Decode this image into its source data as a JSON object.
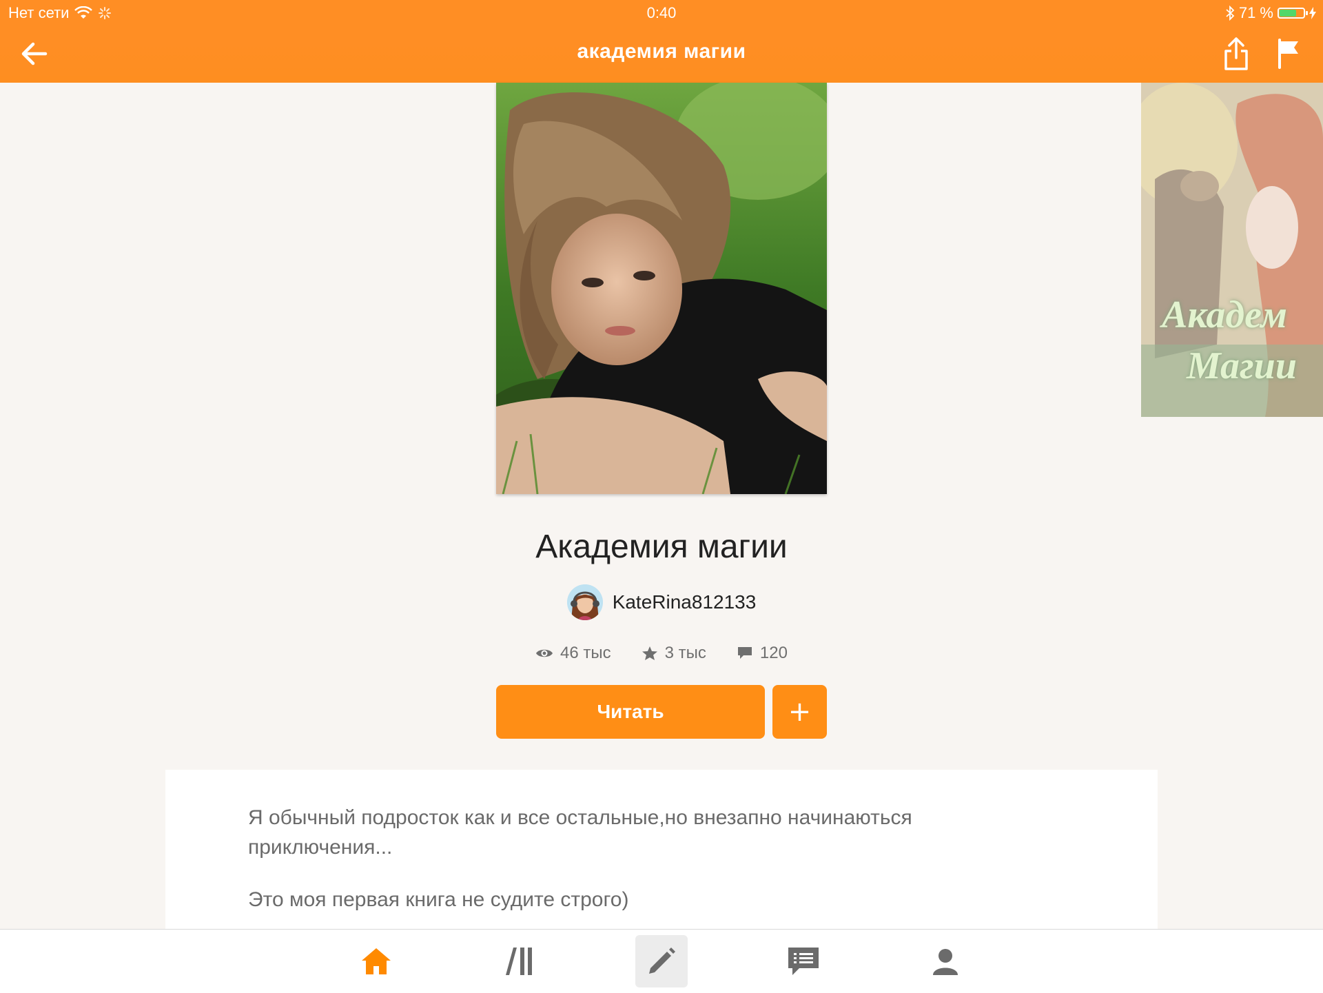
{
  "status_bar": {
    "network": "Нет сети",
    "time": "0:40",
    "battery_percent": "71 %",
    "battery_level": 0.71
  },
  "header": {
    "title": "академия магии"
  },
  "book": {
    "title": "Академия магии",
    "author": "KateRina812133",
    "views": "46 тыс",
    "votes": "3 тыс",
    "comments": "120"
  },
  "next_cover": {
    "line1": "Академ",
    "line2": "Магии"
  },
  "actions": {
    "read_label": "Читать",
    "add_label": "+"
  },
  "description": {
    "paragraph1": "Я обычный подросток как и все остальные,но внезапно начинаються приключения...",
    "paragraph2": "Это моя первая книга не судите строго)"
  },
  "tabs": [
    {
      "name": "home",
      "icon": "home-icon",
      "active": true
    },
    {
      "name": "library",
      "icon": "library-icon",
      "active": false
    },
    {
      "name": "write",
      "icon": "pencil-icon",
      "active": false
    },
    {
      "name": "messages",
      "icon": "messages-icon",
      "active": false
    },
    {
      "name": "profile",
      "icon": "profile-icon",
      "active": false
    }
  ],
  "colors": {
    "accent": "#ff8e15",
    "header": "#ff8e24",
    "active_tab": "#ff8a00",
    "inactive_tab": "#6b6b6b"
  }
}
